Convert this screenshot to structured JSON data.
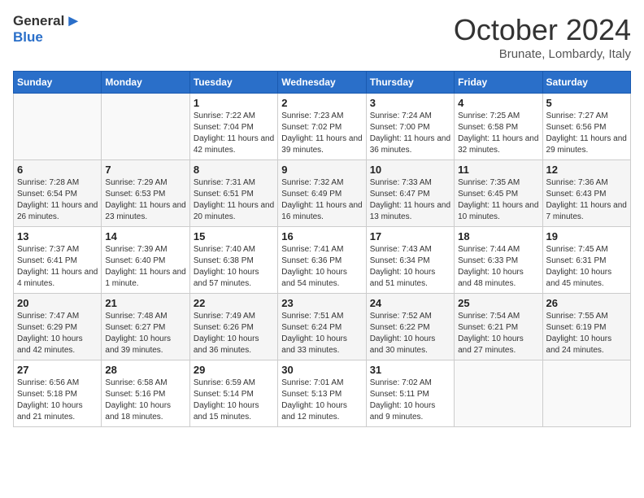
{
  "header": {
    "logo_general": "General",
    "logo_blue": "Blue",
    "month_title": "October 2024",
    "location": "Brunate, Lombardy, Italy"
  },
  "days_of_week": [
    "Sunday",
    "Monday",
    "Tuesday",
    "Wednesday",
    "Thursday",
    "Friday",
    "Saturday"
  ],
  "weeks": [
    [
      {
        "day": "",
        "info": ""
      },
      {
        "day": "",
        "info": ""
      },
      {
        "day": "1",
        "info": "Sunrise: 7:22 AM\nSunset: 7:04 PM\nDaylight: 11 hours and 42 minutes."
      },
      {
        "day": "2",
        "info": "Sunrise: 7:23 AM\nSunset: 7:02 PM\nDaylight: 11 hours and 39 minutes."
      },
      {
        "day": "3",
        "info": "Sunrise: 7:24 AM\nSunset: 7:00 PM\nDaylight: 11 hours and 36 minutes."
      },
      {
        "day": "4",
        "info": "Sunrise: 7:25 AM\nSunset: 6:58 PM\nDaylight: 11 hours and 32 minutes."
      },
      {
        "day": "5",
        "info": "Sunrise: 7:27 AM\nSunset: 6:56 PM\nDaylight: 11 hours and 29 minutes."
      }
    ],
    [
      {
        "day": "6",
        "info": "Sunrise: 7:28 AM\nSunset: 6:54 PM\nDaylight: 11 hours and 26 minutes."
      },
      {
        "day": "7",
        "info": "Sunrise: 7:29 AM\nSunset: 6:53 PM\nDaylight: 11 hours and 23 minutes."
      },
      {
        "day": "8",
        "info": "Sunrise: 7:31 AM\nSunset: 6:51 PM\nDaylight: 11 hours and 20 minutes."
      },
      {
        "day": "9",
        "info": "Sunrise: 7:32 AM\nSunset: 6:49 PM\nDaylight: 11 hours and 16 minutes."
      },
      {
        "day": "10",
        "info": "Sunrise: 7:33 AM\nSunset: 6:47 PM\nDaylight: 11 hours and 13 minutes."
      },
      {
        "day": "11",
        "info": "Sunrise: 7:35 AM\nSunset: 6:45 PM\nDaylight: 11 hours and 10 minutes."
      },
      {
        "day": "12",
        "info": "Sunrise: 7:36 AM\nSunset: 6:43 PM\nDaylight: 11 hours and 7 minutes."
      }
    ],
    [
      {
        "day": "13",
        "info": "Sunrise: 7:37 AM\nSunset: 6:41 PM\nDaylight: 11 hours and 4 minutes."
      },
      {
        "day": "14",
        "info": "Sunrise: 7:39 AM\nSunset: 6:40 PM\nDaylight: 11 hours and 1 minute."
      },
      {
        "day": "15",
        "info": "Sunrise: 7:40 AM\nSunset: 6:38 PM\nDaylight: 10 hours and 57 minutes."
      },
      {
        "day": "16",
        "info": "Sunrise: 7:41 AM\nSunset: 6:36 PM\nDaylight: 10 hours and 54 minutes."
      },
      {
        "day": "17",
        "info": "Sunrise: 7:43 AM\nSunset: 6:34 PM\nDaylight: 10 hours and 51 minutes."
      },
      {
        "day": "18",
        "info": "Sunrise: 7:44 AM\nSunset: 6:33 PM\nDaylight: 10 hours and 48 minutes."
      },
      {
        "day": "19",
        "info": "Sunrise: 7:45 AM\nSunset: 6:31 PM\nDaylight: 10 hours and 45 minutes."
      }
    ],
    [
      {
        "day": "20",
        "info": "Sunrise: 7:47 AM\nSunset: 6:29 PM\nDaylight: 10 hours and 42 minutes."
      },
      {
        "day": "21",
        "info": "Sunrise: 7:48 AM\nSunset: 6:27 PM\nDaylight: 10 hours and 39 minutes."
      },
      {
        "day": "22",
        "info": "Sunrise: 7:49 AM\nSunset: 6:26 PM\nDaylight: 10 hours and 36 minutes."
      },
      {
        "day": "23",
        "info": "Sunrise: 7:51 AM\nSunset: 6:24 PM\nDaylight: 10 hours and 33 minutes."
      },
      {
        "day": "24",
        "info": "Sunrise: 7:52 AM\nSunset: 6:22 PM\nDaylight: 10 hours and 30 minutes."
      },
      {
        "day": "25",
        "info": "Sunrise: 7:54 AM\nSunset: 6:21 PM\nDaylight: 10 hours and 27 minutes."
      },
      {
        "day": "26",
        "info": "Sunrise: 7:55 AM\nSunset: 6:19 PM\nDaylight: 10 hours and 24 minutes."
      }
    ],
    [
      {
        "day": "27",
        "info": "Sunrise: 6:56 AM\nSunset: 5:18 PM\nDaylight: 10 hours and 21 minutes."
      },
      {
        "day": "28",
        "info": "Sunrise: 6:58 AM\nSunset: 5:16 PM\nDaylight: 10 hours and 18 minutes."
      },
      {
        "day": "29",
        "info": "Sunrise: 6:59 AM\nSunset: 5:14 PM\nDaylight: 10 hours and 15 minutes."
      },
      {
        "day": "30",
        "info": "Sunrise: 7:01 AM\nSunset: 5:13 PM\nDaylight: 10 hours and 12 minutes."
      },
      {
        "day": "31",
        "info": "Sunrise: 7:02 AM\nSunset: 5:11 PM\nDaylight: 10 hours and 9 minutes."
      },
      {
        "day": "",
        "info": ""
      },
      {
        "day": "",
        "info": ""
      }
    ]
  ]
}
